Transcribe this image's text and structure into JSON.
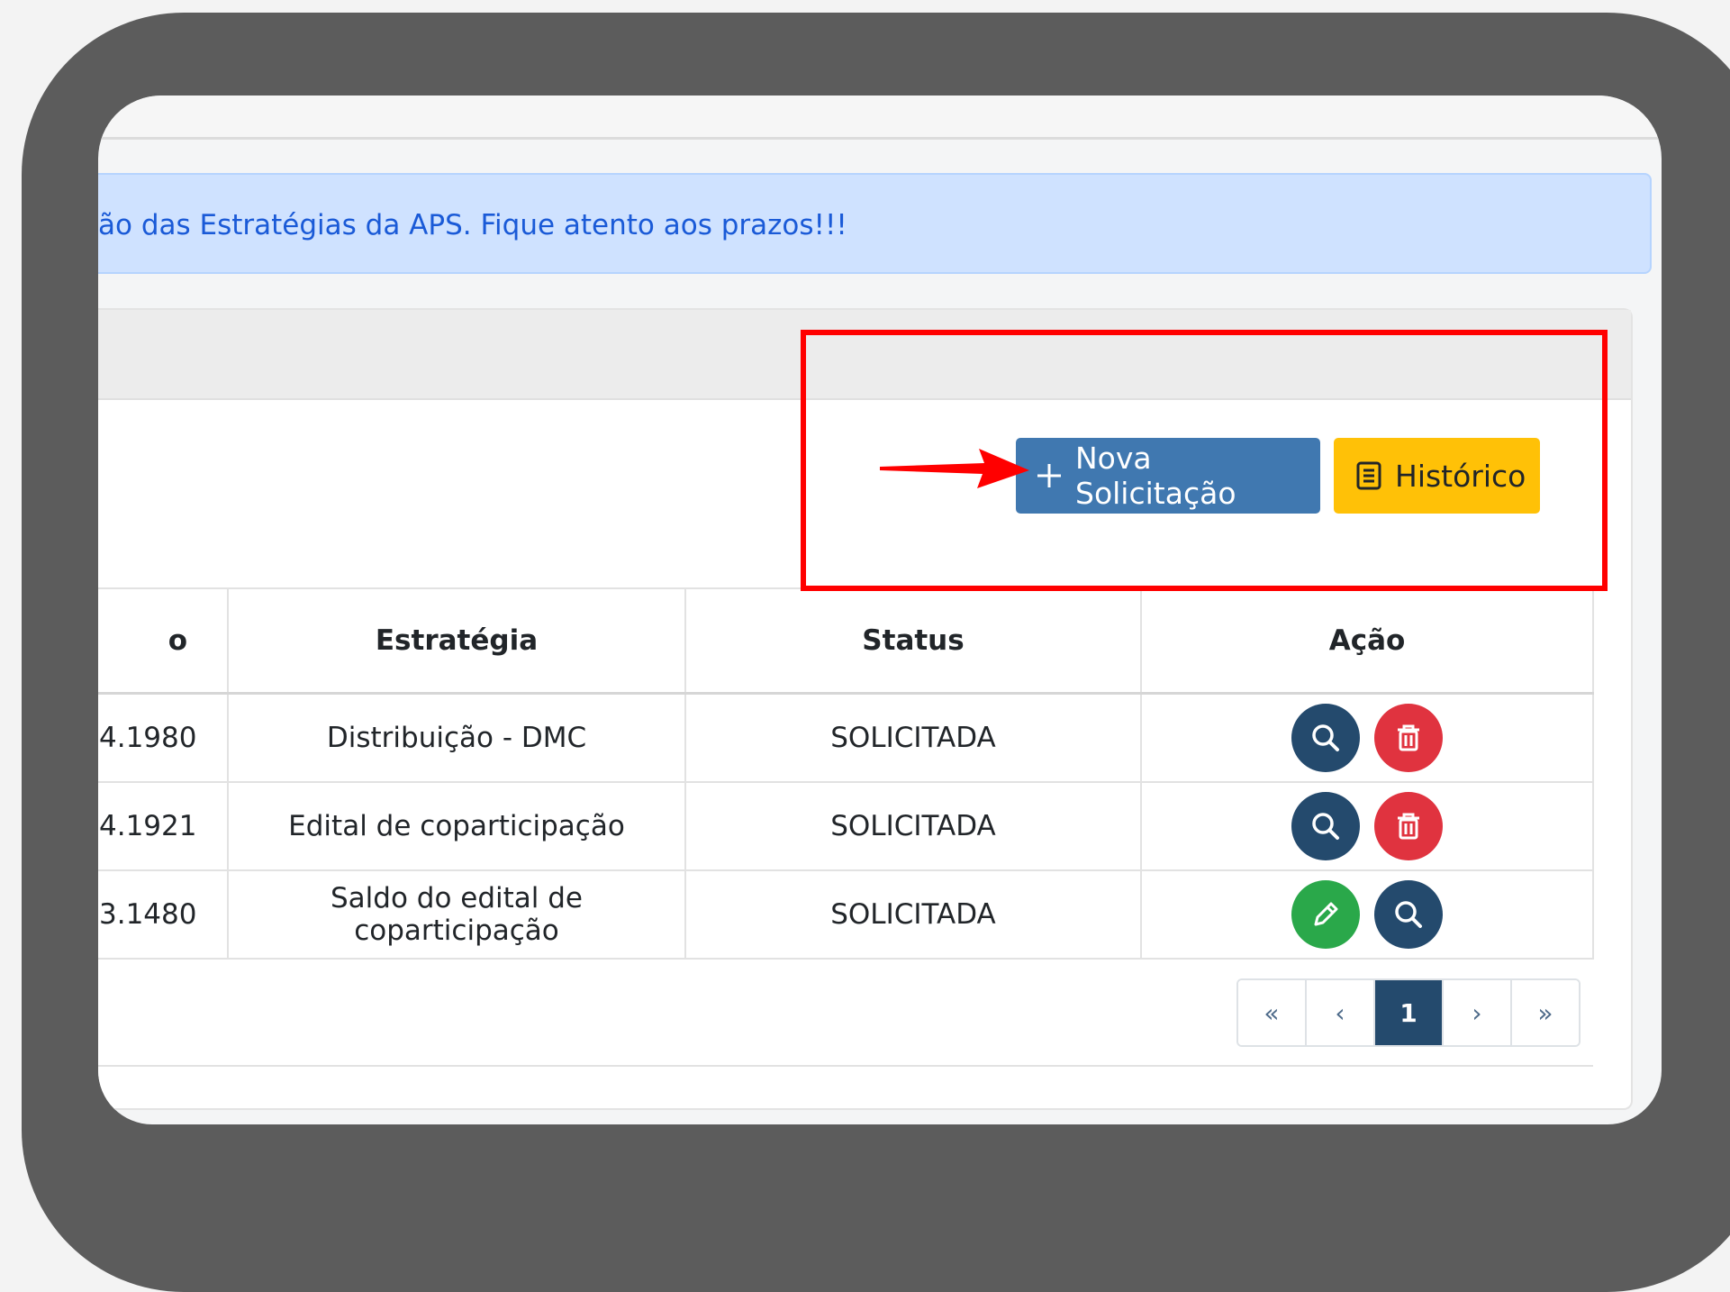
{
  "alert": {
    "text": "ão das Estratégias da APS. Fique atento aos prazos!!!"
  },
  "toolbar": {
    "new_label": "Nova Solicitação",
    "history_label": "Histórico"
  },
  "table": {
    "headers": [
      "o",
      "Estratégia",
      "Status",
      "Ação"
    ],
    "rows": [
      {
        "id": "4.1980",
        "estrategia": "Distribuição - DMC",
        "status": "SOLICITADA",
        "actions": [
          "search-icon",
          "trash-icon"
        ]
      },
      {
        "id": "4.1921",
        "estrategia": "Edital de coparticipação",
        "status": "SOLICITADA",
        "actions": [
          "search-icon",
          "trash-icon"
        ]
      },
      {
        "id": "3.1480",
        "estrategia": "Saldo do edital de coparticipação",
        "status": "SOLICITADA",
        "actions": [
          "pencil-icon",
          "search-icon"
        ]
      }
    ]
  },
  "pagination": {
    "first": "«",
    "prev": "‹",
    "current": "1",
    "next": "›",
    "last": "»"
  },
  "colors": {
    "primary": "#4078b0",
    "warning": "#ffc107",
    "dark_blue": "#244a6d",
    "danger": "#e0333f",
    "success": "#2aa84a",
    "annotation": "#ff0000"
  }
}
